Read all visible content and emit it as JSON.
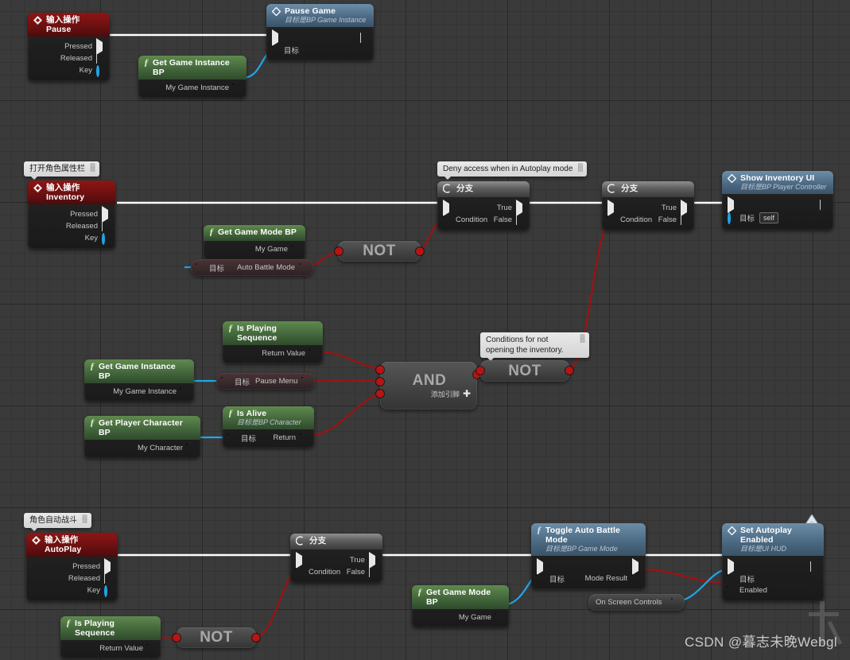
{
  "app": {
    "title": "Unreal Engine Blueprint Event Graph",
    "watermark": "CSDN @暮志未晚Webgl"
  },
  "comments": [
    {
      "name": "open-character-attribute-panel",
      "text": "打开角色属性栏"
    },
    {
      "name": "deny-access-autoplay",
      "text": "Deny access when in Autoplay mode"
    },
    {
      "name": "conditions-not-opening-inventory",
      "text": "Conditions for not opening the inventory."
    },
    {
      "name": "character-auto-battle",
      "text": "角色自动战斗"
    }
  ],
  "nodes": {
    "input_pause": {
      "title": "输入操作Pause",
      "pins": [
        {
          "label": "Pressed",
          "kind": "exec-out-filled"
        },
        {
          "label": "Released",
          "kind": "exec-out-hollow"
        },
        {
          "label": "Key",
          "kind": "data-blue-ring"
        }
      ]
    },
    "pause_game": {
      "title": "Pause Game",
      "subtitle": "目标是BP Game Instance",
      "target_label": "目标"
    },
    "get_game_instance_bp_top": {
      "title": "Get Game Instance BP",
      "out_label": "My Game Instance"
    },
    "input_inventory": {
      "title": "输入操作Inventory",
      "pins": [
        {
          "label": "Pressed",
          "kind": "exec-out-filled"
        },
        {
          "label": "Released",
          "kind": "exec-out-hollow"
        },
        {
          "label": "Key",
          "kind": "data-blue-ring"
        }
      ]
    },
    "get_game_mode_bp_mid": {
      "title": "Get Game Mode BP",
      "out_label": "My Game"
    },
    "auto_battle_mode": {
      "target_label": "目标",
      "out_label": "Auto Battle Mode"
    },
    "not_1": {
      "label": "NOT"
    },
    "branch_1": {
      "title": "分支",
      "true_label": "True",
      "false_label": "False",
      "condition_label": "Condition"
    },
    "branch_2": {
      "title": "分支",
      "true_label": "True",
      "false_label": "False",
      "condition_label": "Condition"
    },
    "show_inventory_ui": {
      "title": "Show Inventory UI",
      "subtitle": "目标是BP Player Controller",
      "target_label": "目标",
      "target_value": "self"
    },
    "is_playing_sequence_mid": {
      "title": "Is Playing Sequence",
      "out_label": "Return Value"
    },
    "get_game_instance_bp_mid": {
      "title": "Get Game Instance BP",
      "out_label": "My Game Instance"
    },
    "pause_menu": {
      "target_label": "目标",
      "out_label": "Pause Menu"
    },
    "get_player_character_bp": {
      "title": "Get Player Character BP",
      "out_label": "My Character"
    },
    "is_alive": {
      "title": "Is Alive",
      "subtitle": "目标是BP Character",
      "target_label": "目标",
      "out_label": "Return"
    },
    "and_node": {
      "label": "AND",
      "add_pin": "添加引脚"
    },
    "not_2": {
      "label": "NOT"
    },
    "input_autoplay": {
      "title": "输入操作AutoPlay",
      "pins": [
        {
          "label": "Pressed",
          "kind": "exec-out-filled"
        },
        {
          "label": "Released",
          "kind": "exec-out-hollow"
        },
        {
          "label": "Key",
          "kind": "data-blue-ring"
        }
      ]
    },
    "is_playing_sequence_bottom": {
      "title": "Is Playing Sequence",
      "out_label": "Return Value"
    },
    "not_3": {
      "label": "NOT"
    },
    "branch_3": {
      "title": "分支",
      "true_label": "True",
      "false_label": "False",
      "condition_label": "Condition"
    },
    "toggle_auto_battle_mode": {
      "title": "Toggle Auto Battle Mode",
      "subtitle": "目标是BP Game Mode",
      "target_label": "目标",
      "out_label": "Mode Result"
    },
    "get_game_mode_bp_bottom": {
      "title": "Get Game Mode BP",
      "out_label": "My Game"
    },
    "on_screen_controls": {
      "label": "On Screen Controls"
    },
    "set_autoplay_enabled": {
      "title": "Set Autoplay Enabled",
      "subtitle": "目标是UI HUD",
      "target_label": "目标",
      "enabled_label": "Enabled"
    }
  },
  "colors": {
    "exec_wire": "#ffffff",
    "bool_wire": "#9e1212",
    "object_wire": "#1ea7e8",
    "event_header": "#8e1515",
    "function_header": "#5f8a4e",
    "blue_header": "#6d8ea8",
    "canvas": "#3a3a3a"
  }
}
